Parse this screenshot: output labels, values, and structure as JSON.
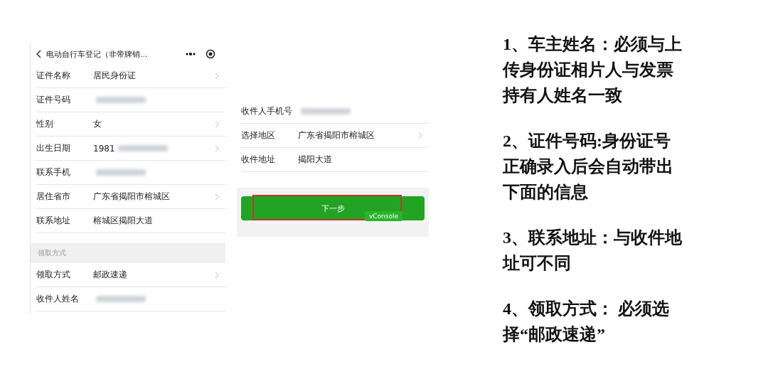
{
  "form_screen": {
    "title": "电动自行车登记（非带牌销...",
    "rows": [
      {
        "kind": "field",
        "label": "证件名称",
        "value": "居民身份证",
        "redacted": false,
        "chevron": true
      },
      {
        "kind": "field",
        "label": "证件号码",
        "redacted": true,
        "chevron": false
      },
      {
        "kind": "field",
        "label": "性别",
        "value": "女",
        "redacted": false,
        "chevron": true
      },
      {
        "kind": "field",
        "label": "出生日期",
        "value": "1981",
        "redacted": true,
        "chevron": true
      },
      {
        "kind": "field",
        "label": "联系手机",
        "redacted": true,
        "chevron": false
      },
      {
        "kind": "field",
        "label": "居住省市",
        "value": "广东省揭阳市榕城区",
        "redacted": false,
        "chevron": true
      },
      {
        "kind": "field",
        "label": "联系地址",
        "value": "榕城区揭阳大道",
        "redacted": false,
        "chevron": false
      },
      {
        "kind": "section",
        "label": "领取方式"
      },
      {
        "kind": "field",
        "label": "领取方式",
        "value": "邮政速递",
        "redacted": false,
        "chevron": true
      },
      {
        "kind": "field",
        "label": "收件人姓名",
        "redacted": true,
        "chevron": false
      }
    ]
  },
  "address_screen": {
    "rows": [
      {
        "kind": "field",
        "label": "收件人手机号",
        "redacted": true,
        "chevron": false
      },
      {
        "kind": "field",
        "label": "选择地区",
        "value": "广东省揭阳市榕城区",
        "redacted": false,
        "chevron": true
      },
      {
        "kind": "field",
        "label": "收件地址",
        "value": "揭阳大道",
        "redacted": false,
        "chevron": false
      }
    ],
    "button": "下一步",
    "highlighted": true,
    "badge": "vConsole"
  },
  "notes": [
    "1、车主姓名：必须与上传身份证相片人与发票持有人姓名一致",
    "2、证件号码:身份证号正确录入后会自动带出下面的信息",
    "3、联系地址：与收件地址可不同",
    "4、领取方式： 必须选择“邮政速递”"
  ]
}
